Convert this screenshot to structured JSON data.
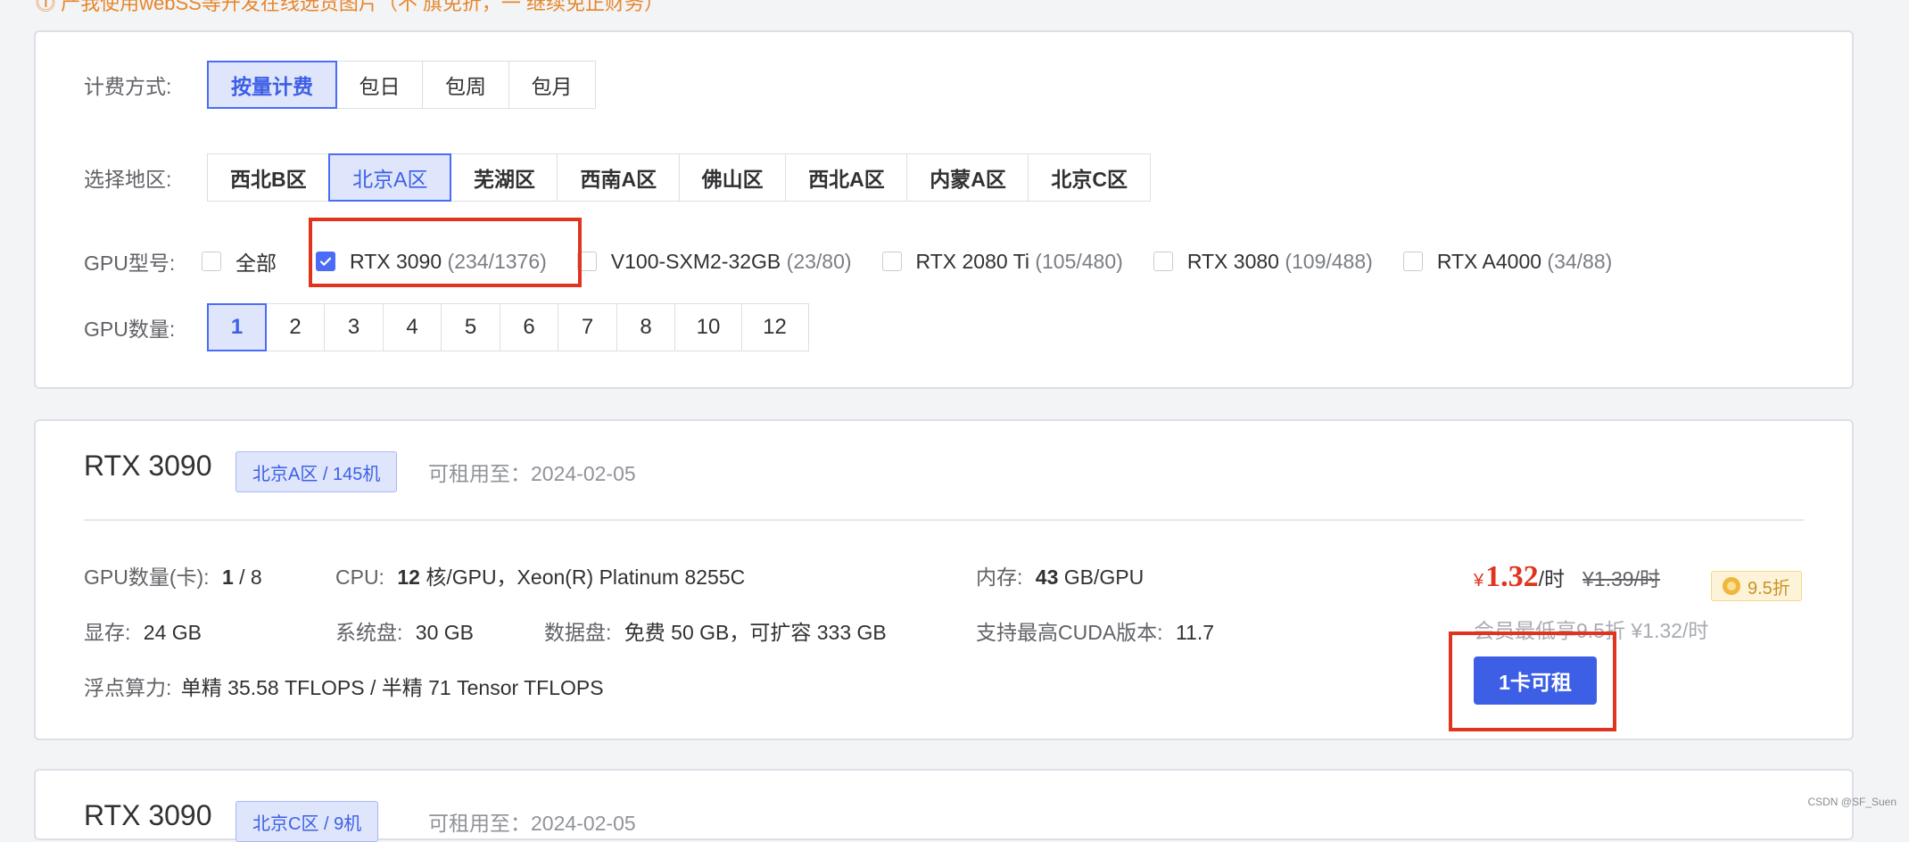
{
  "top_notice": "⓵ 产我使用webSS等开发在线选货图片（不 旗免折，一 继续免正财务）",
  "billing": {
    "label": "计费方式:",
    "options": [
      "按量计费",
      "包日",
      "包周",
      "包月"
    ],
    "selected": "按量计费"
  },
  "region": {
    "label": "选择地区:",
    "options": [
      "西北B区",
      "北京A区",
      "芜湖区",
      "西南A区",
      "佛山区",
      "西北A区",
      "内蒙A区",
      "北京C区"
    ],
    "selected": "北京A区"
  },
  "gpu_model": {
    "label": "GPU型号:",
    "options": [
      {
        "name": "全部",
        "count": "",
        "checked": false
      },
      {
        "name": "RTX 3090",
        "count": "(234/1376)",
        "checked": true
      },
      {
        "name": "V100-SXM2-32GB",
        "count": "(23/80)",
        "checked": false
      },
      {
        "name": "RTX 2080 Ti",
        "count": "(105/480)",
        "checked": false
      },
      {
        "name": "RTX 3080",
        "count": "(109/488)",
        "checked": false
      },
      {
        "name": "RTX A4000",
        "count": "(34/88)",
        "checked": false
      }
    ]
  },
  "gpu_count": {
    "label": "GPU数量:",
    "options": [
      "1",
      "2",
      "3",
      "4",
      "5",
      "6",
      "7",
      "8",
      "10",
      "12"
    ],
    "selected": "1"
  },
  "card": {
    "gpu_name": "RTX 3090",
    "region_tag": "北京A区 / 145机",
    "available_until": "可租用至：2024-02-05",
    "specs": {
      "gpu_count_label": "GPU数量(卡):",
      "gpu_count_avail": "1",
      "gpu_count_total": " / 8",
      "cpu_label": "CPU:",
      "cpu_cores": "12",
      "cpu_rest": "核/GPU，Xeon(R) Platinum 8255C",
      "mem_label": "内存:",
      "mem_value": "43",
      "mem_unit": "GB/GPU",
      "vram_label": "显存:",
      "vram_value": "24 GB",
      "sysdisk_label": "系统盘:",
      "sysdisk_value": "30 GB",
      "datadisk_label": "数据盘:",
      "datadisk_value": "免费 50 GB，可扩容 333 GB",
      "cuda_label": "支持最高CUDA版本:",
      "cuda_value": "11.7",
      "flops_label": "浮点算力:",
      "flops_value": "单精 35.58 TFLOPS / 半精 71 Tensor TFLOPS"
    },
    "price": {
      "currency": "¥",
      "value": "1.32",
      "unit": "/时",
      "original": "¥1.39/时",
      "discount": "9.5折",
      "vip_note": "会员最低享9.5折  ¥1.32/时"
    },
    "rent_button": "1卡可租"
  },
  "card2": {
    "gpu_name": "RTX 3090",
    "region_tag": "北京C区 / 9机",
    "available_until": "可租用至：2024-02-05"
  },
  "credit": "CSDN @SF_Suen",
  "colors": {
    "accent": "#4a6cf7",
    "price": "#e0341e",
    "highlight": "#e0341e"
  }
}
